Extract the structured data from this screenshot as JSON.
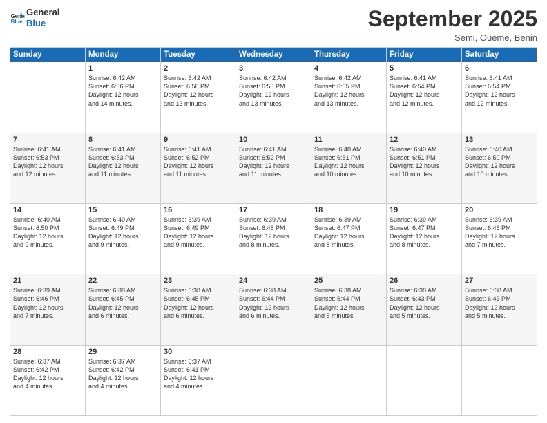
{
  "logo": {
    "line1": "General",
    "line2": "Blue"
  },
  "title": "September 2025",
  "subtitle": "Semi, Oueme, Benin",
  "days_header": [
    "Sunday",
    "Monday",
    "Tuesday",
    "Wednesday",
    "Thursday",
    "Friday",
    "Saturday"
  ],
  "weeks": [
    [
      {
        "day": "",
        "info": ""
      },
      {
        "day": "1",
        "info": "Sunrise: 6:42 AM\nSunset: 6:56 PM\nDaylight: 12 hours\nand 14 minutes."
      },
      {
        "day": "2",
        "info": "Sunrise: 6:42 AM\nSunset: 6:56 PM\nDaylight: 12 hours\nand 13 minutes."
      },
      {
        "day": "3",
        "info": "Sunrise: 6:42 AM\nSunset: 6:55 PM\nDaylight: 12 hours\nand 13 minutes."
      },
      {
        "day": "4",
        "info": "Sunrise: 6:42 AM\nSunset: 6:55 PM\nDaylight: 12 hours\nand 13 minutes."
      },
      {
        "day": "5",
        "info": "Sunrise: 6:41 AM\nSunset: 6:54 PM\nDaylight: 12 hours\nand 12 minutes."
      },
      {
        "day": "6",
        "info": "Sunrise: 6:41 AM\nSunset: 6:54 PM\nDaylight: 12 hours\nand 12 minutes."
      }
    ],
    [
      {
        "day": "7",
        "info": "Sunrise: 6:41 AM\nSunset: 6:53 PM\nDaylight: 12 hours\nand 12 minutes."
      },
      {
        "day": "8",
        "info": "Sunrise: 6:41 AM\nSunset: 6:53 PM\nDaylight: 12 hours\nand 11 minutes."
      },
      {
        "day": "9",
        "info": "Sunrise: 6:41 AM\nSunset: 6:52 PM\nDaylight: 12 hours\nand 11 minutes."
      },
      {
        "day": "10",
        "info": "Sunrise: 6:41 AM\nSunset: 6:52 PM\nDaylight: 12 hours\nand 11 minutes."
      },
      {
        "day": "11",
        "info": "Sunrise: 6:40 AM\nSunset: 6:51 PM\nDaylight: 12 hours\nand 10 minutes."
      },
      {
        "day": "12",
        "info": "Sunrise: 6:40 AM\nSunset: 6:51 PM\nDaylight: 12 hours\nand 10 minutes."
      },
      {
        "day": "13",
        "info": "Sunrise: 6:40 AM\nSunset: 6:50 PM\nDaylight: 12 hours\nand 10 minutes."
      }
    ],
    [
      {
        "day": "14",
        "info": "Sunrise: 6:40 AM\nSunset: 6:50 PM\nDaylight: 12 hours\nand 9 minutes."
      },
      {
        "day": "15",
        "info": "Sunrise: 6:40 AM\nSunset: 6:49 PM\nDaylight: 12 hours\nand 9 minutes."
      },
      {
        "day": "16",
        "info": "Sunrise: 6:39 AM\nSunset: 6:49 PM\nDaylight: 12 hours\nand 9 minutes."
      },
      {
        "day": "17",
        "info": "Sunrise: 6:39 AM\nSunset: 6:48 PM\nDaylight: 12 hours\nand 8 minutes."
      },
      {
        "day": "18",
        "info": "Sunrise: 6:39 AM\nSunset: 6:47 PM\nDaylight: 12 hours\nand 8 minutes."
      },
      {
        "day": "19",
        "info": "Sunrise: 6:39 AM\nSunset: 6:47 PM\nDaylight: 12 hours\nand 8 minutes."
      },
      {
        "day": "20",
        "info": "Sunrise: 6:39 AM\nSunset: 6:46 PM\nDaylight: 12 hours\nand 7 minutes."
      }
    ],
    [
      {
        "day": "21",
        "info": "Sunrise: 6:39 AM\nSunset: 6:46 PM\nDaylight: 12 hours\nand 7 minutes."
      },
      {
        "day": "22",
        "info": "Sunrise: 6:38 AM\nSunset: 6:45 PM\nDaylight: 12 hours\nand 6 minutes."
      },
      {
        "day": "23",
        "info": "Sunrise: 6:38 AM\nSunset: 6:45 PM\nDaylight: 12 hours\nand 6 minutes."
      },
      {
        "day": "24",
        "info": "Sunrise: 6:38 AM\nSunset: 6:44 PM\nDaylight: 12 hours\nand 6 minutes."
      },
      {
        "day": "25",
        "info": "Sunrise: 6:38 AM\nSunset: 6:44 PM\nDaylight: 12 hours\nand 5 minutes."
      },
      {
        "day": "26",
        "info": "Sunrise: 6:38 AM\nSunset: 6:43 PM\nDaylight: 12 hours\nand 5 minutes."
      },
      {
        "day": "27",
        "info": "Sunrise: 6:38 AM\nSunset: 6:43 PM\nDaylight: 12 hours\nand 5 minutes."
      }
    ],
    [
      {
        "day": "28",
        "info": "Sunrise: 6:37 AM\nSunset: 6:42 PM\nDaylight: 12 hours\nand 4 minutes."
      },
      {
        "day": "29",
        "info": "Sunrise: 6:37 AM\nSunset: 6:42 PM\nDaylight: 12 hours\nand 4 minutes."
      },
      {
        "day": "30",
        "info": "Sunrise: 6:37 AM\nSunset: 6:41 PM\nDaylight: 12 hours\nand 4 minutes."
      },
      {
        "day": "",
        "info": ""
      },
      {
        "day": "",
        "info": ""
      },
      {
        "day": "",
        "info": ""
      },
      {
        "day": "",
        "info": ""
      }
    ]
  ]
}
